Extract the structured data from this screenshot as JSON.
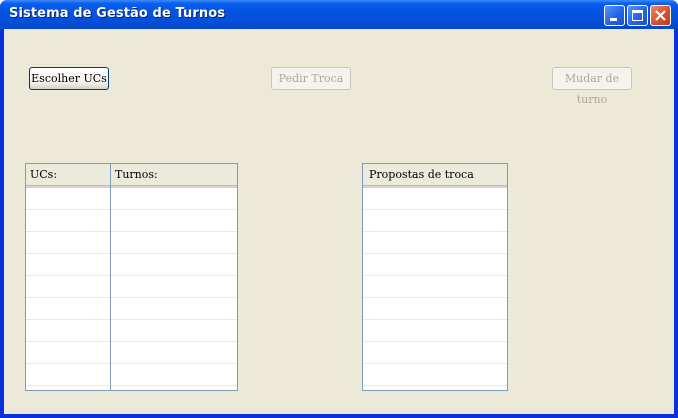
{
  "window": {
    "title": "Sistema de Gestão de Turnos"
  },
  "toolbar": {
    "choose_ucs_label": "Escolher UCs",
    "request_swap_label": "Pedir Troca",
    "change_shift_label": "Mudar de turno"
  },
  "ucs_table": {
    "columns": [
      "UCs:",
      "Turnos:"
    ]
  },
  "proposals_table": {
    "columns": [
      "Propostas de troca"
    ]
  }
}
